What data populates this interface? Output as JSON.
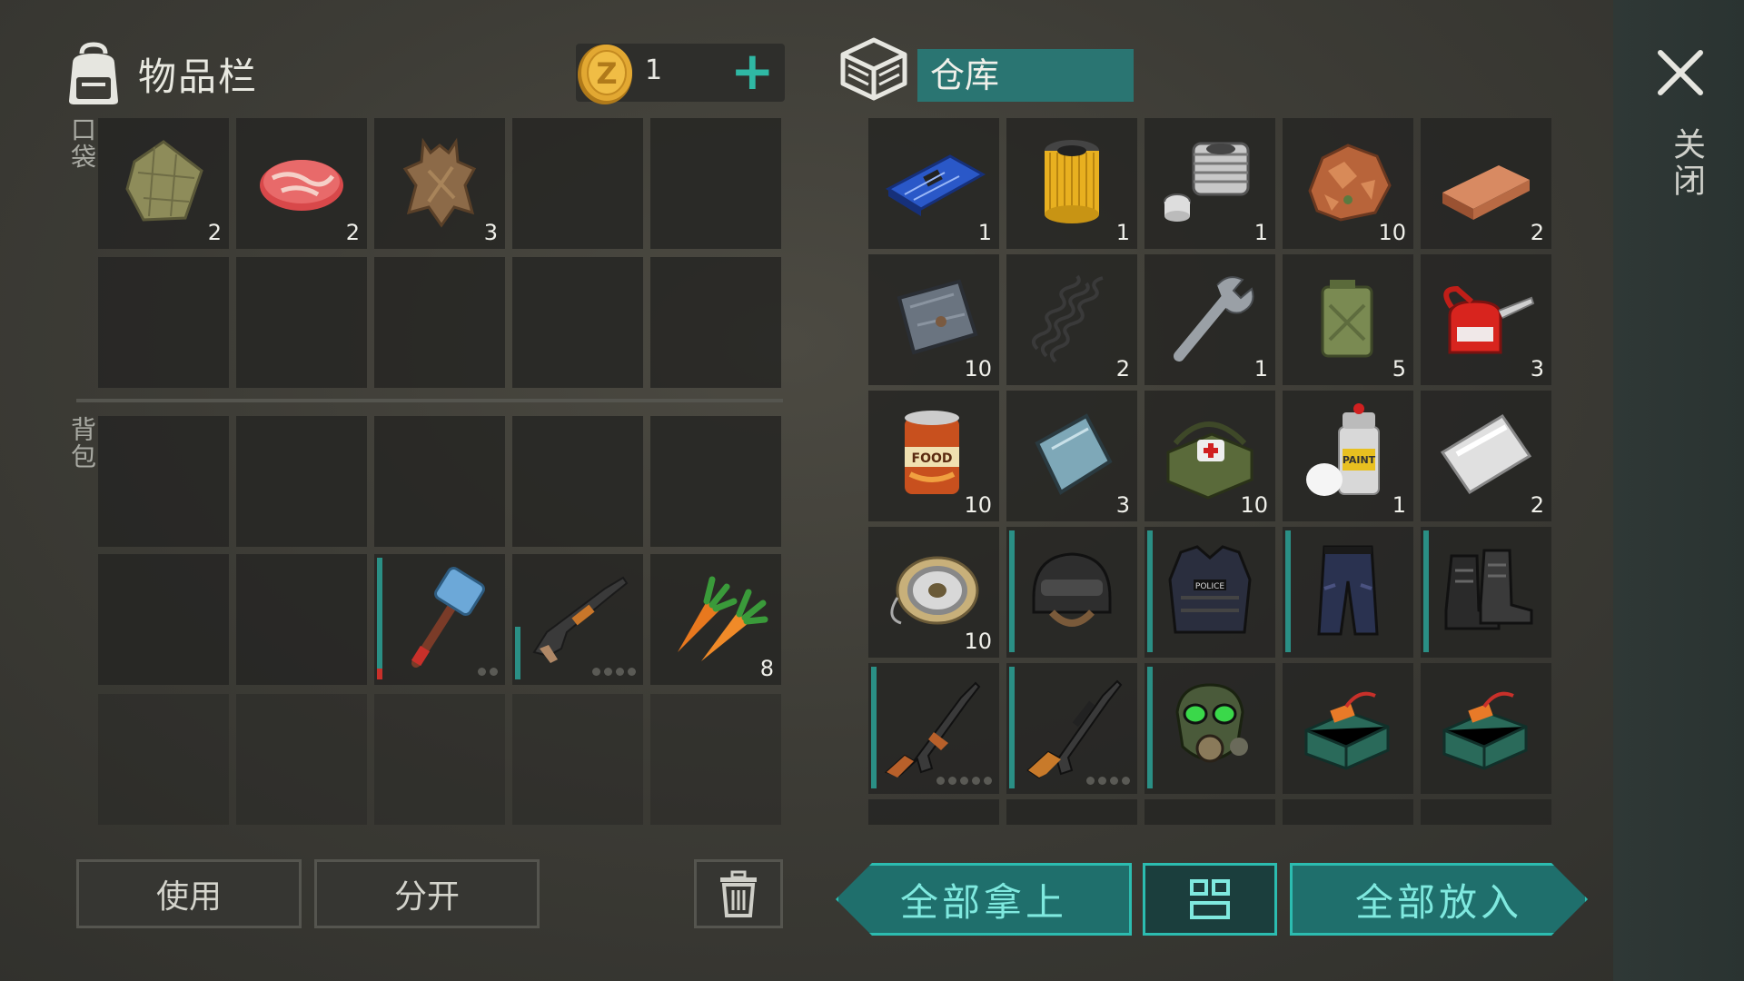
{
  "inventory": {
    "title": "物品栏",
    "coins": "1",
    "plus": "+",
    "pocket_label": "口袋",
    "backpack_label": "背包",
    "pocket_slots": [
      {
        "icon": "cloth-icon",
        "qty": "2"
      },
      {
        "icon": "raw-meat-icon",
        "qty": "2"
      },
      {
        "icon": "animal-hide-icon",
        "qty": "3"
      },
      {
        "icon": "",
        "qty": ""
      },
      {
        "icon": "",
        "qty": ""
      },
      {
        "icon": "",
        "qty": ""
      },
      {
        "icon": "",
        "qty": ""
      },
      {
        "icon": "",
        "qty": ""
      },
      {
        "icon": "",
        "qty": ""
      },
      {
        "icon": "",
        "qty": ""
      }
    ],
    "backpack_slots": [
      {
        "icon": "",
        "qty": ""
      },
      {
        "icon": "",
        "qty": ""
      },
      {
        "icon": "",
        "qty": ""
      },
      {
        "icon": "",
        "qty": ""
      },
      {
        "icon": "",
        "qty": ""
      },
      {
        "icon": "",
        "qty": ""
      },
      {
        "icon": "",
        "qty": ""
      },
      {
        "icon": "sledgehammer-icon",
        "qty": ""
      },
      {
        "icon": "shotgun-icon",
        "qty": ""
      },
      {
        "icon": "carrot-icon",
        "qty": "8"
      }
    ]
  },
  "storage": {
    "title": "仓库",
    "slots": [
      {
        "icon": "circuit-board-icon",
        "qty": "1"
      },
      {
        "icon": "oil-filter-icon",
        "qty": "1"
      },
      {
        "icon": "engine-cylinder-icon",
        "qty": "1"
      },
      {
        "icon": "copper-ore-icon",
        "qty": "10"
      },
      {
        "icon": "copper-ingot-icon",
        "qty": "2"
      },
      {
        "icon": "iron-plate-icon",
        "qty": "10"
      },
      {
        "icon": "spring-icon",
        "qty": "2"
      },
      {
        "icon": "wrench-icon",
        "qty": "1"
      },
      {
        "icon": "jerrycan-icon",
        "qty": "5"
      },
      {
        "icon": "oil-can-icon",
        "qty": "3"
      },
      {
        "icon": "canned-food-icon",
        "qty": "10"
      },
      {
        "icon": "glass-plate-icon",
        "qty": "3"
      },
      {
        "icon": "medkit-bag-icon",
        "qty": "10"
      },
      {
        "icon": "spray-paint-icon",
        "qty": "1"
      },
      {
        "icon": "aluminium-plate-icon",
        "qty": "2"
      },
      {
        "icon": "wire-spool-icon",
        "qty": "10"
      },
      {
        "icon": "swat-helmet-icon",
        "qty": ""
      },
      {
        "icon": "police-vest-icon",
        "qty": ""
      },
      {
        "icon": "police-pants-icon",
        "qty": ""
      },
      {
        "icon": "combat-boots-icon",
        "qty": ""
      },
      {
        "icon": "ak-rifle-icon",
        "qty": ""
      },
      {
        "icon": "sniper-rifle-icon",
        "qty": ""
      },
      {
        "icon": "gas-mask-icon",
        "qty": ""
      },
      {
        "icon": "c4-explosive-icon",
        "qty": ""
      },
      {
        "icon": "c4-explosive-icon",
        "qty": ""
      }
    ]
  },
  "close_label": "关闭",
  "buttons": {
    "use": "使用",
    "split": "分开",
    "take_all": "全部拿上",
    "put_all": "全部放入"
  },
  "colors": {
    "accent": "#2cbcb0",
    "tab": "#2a7572",
    "teal_button": "#1f6f6c"
  }
}
